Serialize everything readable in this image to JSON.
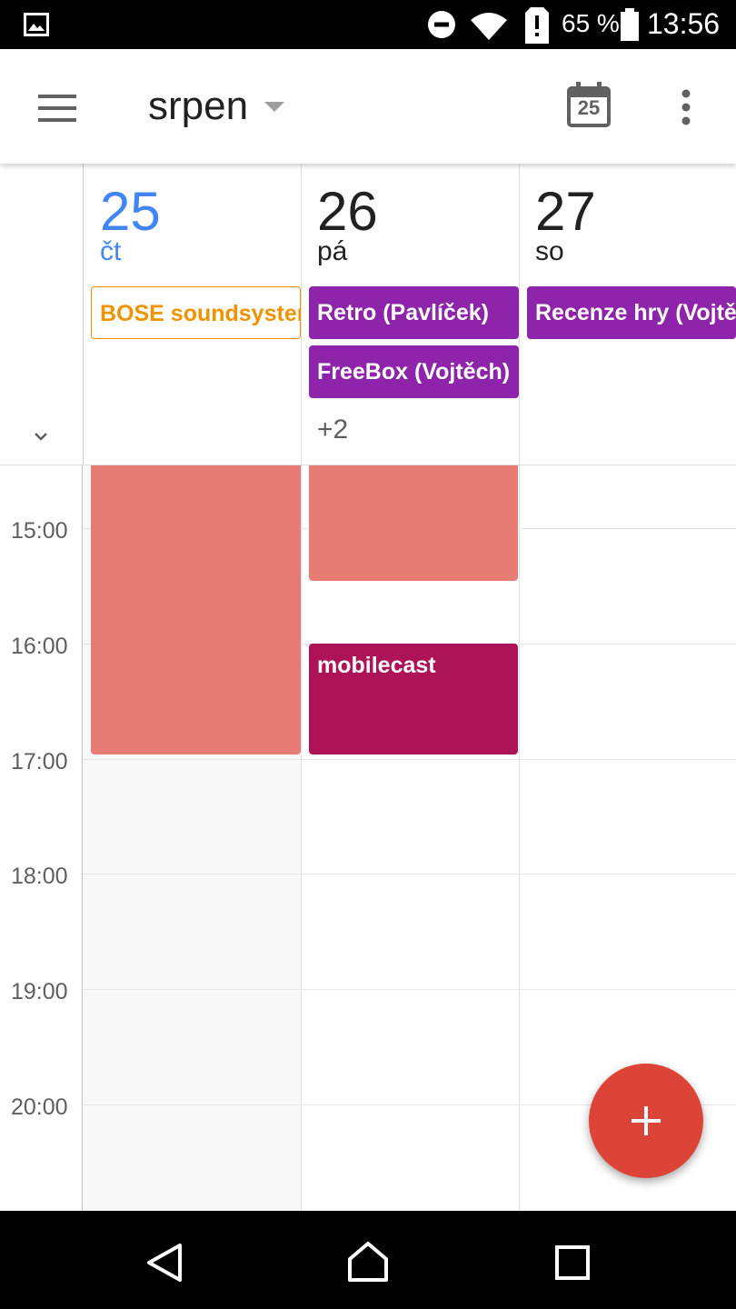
{
  "status_bar": {
    "battery_text": "65 %",
    "time": "13:56",
    "icons": [
      "image-notification-icon",
      "do-not-disturb-icon",
      "wifi-icon",
      "sim-alert-icon",
      "battery-icon"
    ]
  },
  "app_bar": {
    "month": "srpen",
    "today_icon_day": "25",
    "icons": [
      "menu-icon",
      "dropdown-arrow-icon",
      "today-calendar-icon",
      "more-vert-icon"
    ]
  },
  "days": [
    {
      "num": "25",
      "name": "čt",
      "is_today": true
    },
    {
      "num": "26",
      "name": "pá",
      "is_today": false
    },
    {
      "num": "27",
      "name": "so",
      "is_today": false
    }
  ],
  "all_day_events": {
    "day25": [
      "BOSE soundsystem"
    ],
    "day26": [
      "Retro (Pavlíček)",
      "FreeBox (Vojtěch)"
    ],
    "day26_more": "+2",
    "day27": [
      "Recenze hry (Vojtěch)"
    ]
  },
  "time_labels": [
    "15:00",
    "16:00",
    "17:00",
    "18:00",
    "19:00",
    "20:00"
  ],
  "timed_events": {
    "mobilecast": "mobilecast"
  },
  "fab_label": "+",
  "colors": {
    "today_blue": "#4285f4",
    "bose_orange": "#f09300",
    "purple": "#8e24aa",
    "salmon": "#e67c73",
    "magenta": "#ad1457",
    "fab_red": "#dc4437"
  },
  "nav_icons": [
    "back-icon",
    "home-icon",
    "recents-icon"
  ]
}
